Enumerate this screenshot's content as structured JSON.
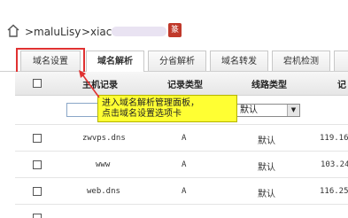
{
  "breadcrumb": {
    "separator": ">",
    "user": "maluLisy",
    "domain_prefix": "xiac",
    "badge": "篆"
  },
  "tabs": [
    {
      "label": "域名设置"
    },
    {
      "label": "域名解析"
    },
    {
      "label": "分省解析"
    },
    {
      "label": "域名转发"
    },
    {
      "label": "宕机检测"
    }
  ],
  "table": {
    "headers": {
      "host": "主机记录",
      "type": "记录类型",
      "line": "线路类型",
      "value": "记"
    },
    "filter": {
      "line_select": "默认",
      "select_arrow": "▼"
    },
    "rows": [
      {
        "host": "zwvps.dns",
        "type": "A",
        "line": "默认",
        "value": "119.161"
      },
      {
        "host": "www",
        "type": "A",
        "line": "默认",
        "value": "103.24"
      },
      {
        "host": "web.dns",
        "type": "A",
        "line": "默认",
        "value": "116.255"
      }
    ]
  },
  "callout": {
    "line1": "进入域名解析管理面板，",
    "line2": "点击域名设置选项卡"
  },
  "colors": {
    "annotation_red": "#e03131",
    "callout_yellow": "#ffff33"
  }
}
